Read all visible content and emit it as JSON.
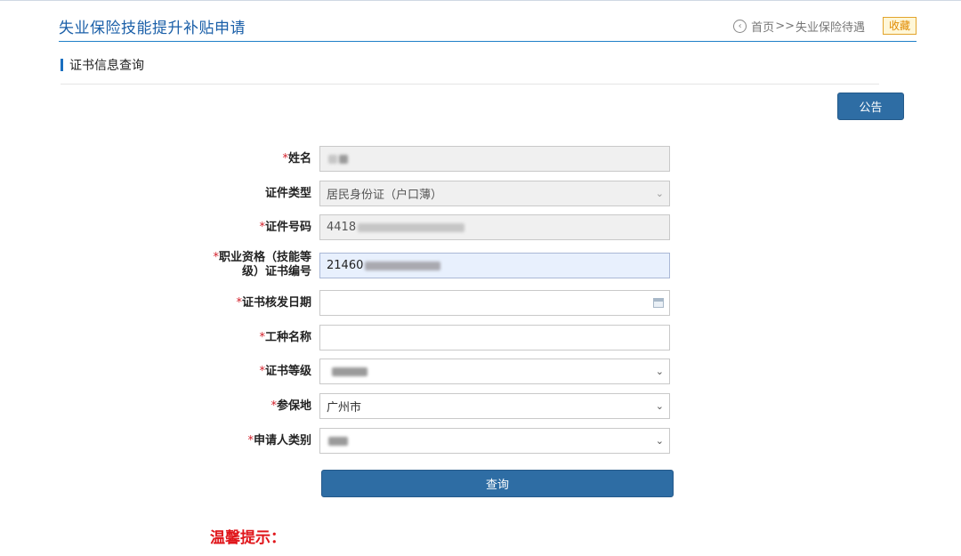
{
  "header": {
    "title": "失业保险技能提升补贴申请",
    "breadcrumb": {
      "home": "首页",
      "separator": ">>",
      "current": "失业保险待遇"
    },
    "favorite_label": "收藏",
    "back_icon": "circle-arrow-icon"
  },
  "section": {
    "title": "证书信息查询"
  },
  "notice_button": "公告",
  "form": {
    "required_mark": "*",
    "name": {
      "label": "姓名",
      "value": ""
    },
    "id_type": {
      "label": "证件类型",
      "value": "居民身份证（户口薄）"
    },
    "id_number": {
      "label": "证件号码",
      "value": "4418"
    },
    "cert_number": {
      "label_line1": "职业资格（技能等",
      "label_line2": "级）证书编号",
      "value": "21460"
    },
    "issue_date": {
      "label": "证书核发日期",
      "value": ""
    },
    "job_name": {
      "label": "工种名称",
      "value": ""
    },
    "cert_level": {
      "label": "证书等级",
      "value": ""
    },
    "insured_place": {
      "label": "参保地",
      "value": "广州市"
    },
    "applicant_type": {
      "label": "申请人类别",
      "value": ""
    }
  },
  "query_button": "查询",
  "tips_title": "温馨提示："
}
